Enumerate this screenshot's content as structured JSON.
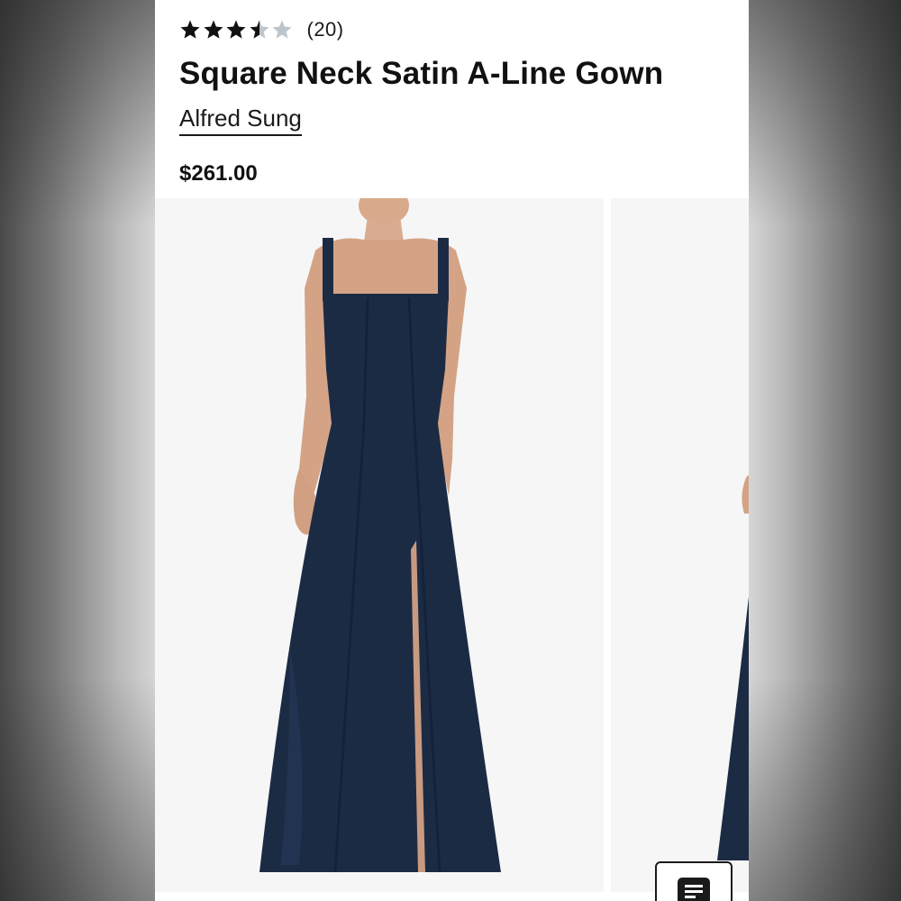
{
  "product": {
    "rating": 3.5,
    "rating_max": 5,
    "review_count": "(20)",
    "title": "Square Neck Satin A-Line Gown",
    "brand": "Alfred Sung",
    "price": "$261.00"
  },
  "gallery": {
    "images": [
      {
        "name": "gown-front-photo",
        "dress_color": "#1c2b44"
      },
      {
        "name": "gown-alt-photo",
        "dress_color": "#1c2b44"
      }
    ]
  },
  "colors": {
    "star_filled": "#111111",
    "star_empty": "#bcc5cb",
    "text": "#111111"
  },
  "icons": {
    "star": "star-icon",
    "list_button": "list-icon"
  }
}
